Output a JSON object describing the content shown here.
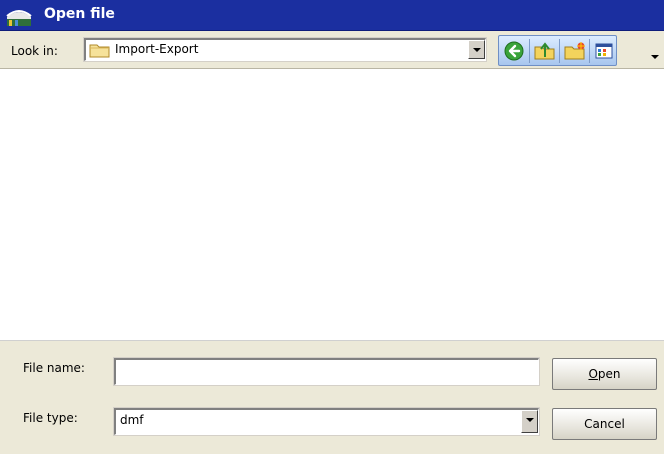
{
  "window": {
    "title": "Open file"
  },
  "toolbar": {
    "look_in_label": "Look in:",
    "look_in_value": "Import-Export",
    "icons": [
      "back-icon",
      "up-folder-icon",
      "new-folder-icon",
      "view-menu-icon"
    ]
  },
  "file_list": {
    "items": []
  },
  "form": {
    "file_name_label": "File name:",
    "file_name_value": "",
    "file_type_label": "File type:",
    "file_type_value": "dmf"
  },
  "buttons": {
    "open_label_underlined": "O",
    "open_label_rest": "pen",
    "cancel_label": "Cancel"
  },
  "colors": {
    "titlebar": "#1b2fa0",
    "panel": "#ece9d8",
    "toolbar_buttons": "#a8c6ee"
  }
}
